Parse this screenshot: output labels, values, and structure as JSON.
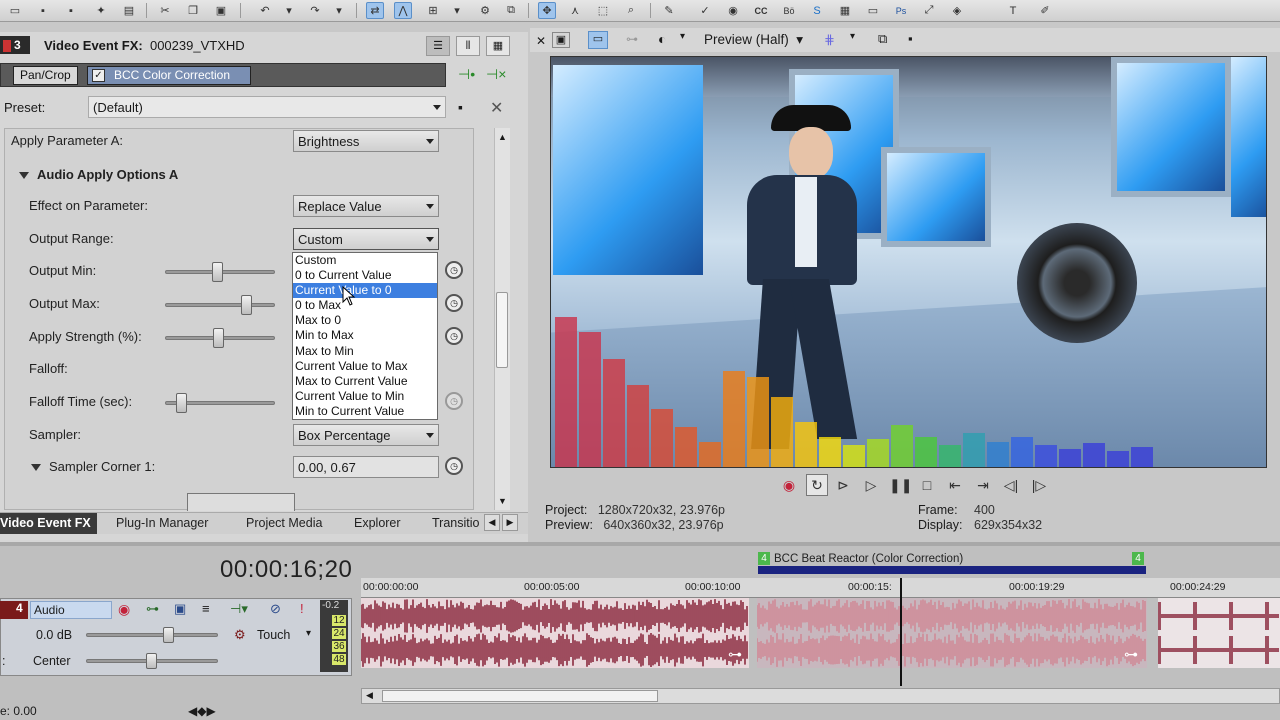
{
  "fx_panel": {
    "track_number": "3",
    "title_label": "Video Event FX:",
    "title_value": "000239_VTXHD",
    "chain": [
      "Pan/Crop",
      "BCC Color Correction"
    ],
    "preset_label": "Preset:",
    "preset_value": "(Default)",
    "params": {
      "apply_param_a_label": "Apply Parameter A:",
      "apply_param_a_value": "Brightness",
      "audio_options_label": "Audio Apply Options A",
      "effect_label": "Effect on Parameter:",
      "effect_value": "Replace Value",
      "output_range_label": "Output Range:",
      "output_range_value": "Custom",
      "output_min_label": "Output Min:",
      "output_max_label": "Output Max:",
      "apply_strength_label": "Apply Strength (%):",
      "falloff_label": "Falloff:",
      "falloff_time_label": "Falloff Time (sec):",
      "sampler_label": "Sampler:",
      "sampler_value": "Box Percentage",
      "sampler_corner_label": "Sampler Corner 1:",
      "sampler_corner_value": "0.00, 0.67"
    },
    "dropdown_options": [
      "Custom",
      "0 to Current Value",
      "Current Value to 0",
      "0 to Max",
      "Max to 0",
      "Min to Max",
      "Max to Min",
      "Current Value to Max",
      "Max to Current Value",
      "Current Value to Min",
      "Min to Current Value"
    ],
    "dropdown_selected_index": 2
  },
  "tabs": [
    "Video Event FX",
    "Plug-In Manager",
    "Project Media",
    "Explorer",
    "Transitio"
  ],
  "preview": {
    "mode_label": "Preview (Half)",
    "project_label": "Project:",
    "project_value": "1280x720x32, 23.976p",
    "preview_label": "Preview:",
    "preview_value": "640x360x32, 23.976p",
    "frame_label": "Frame:",
    "frame_value": "400",
    "display_label": "Display:",
    "display_value": "629x354x32"
  },
  "timeline": {
    "timecode": "00:00:16;20",
    "ruler_ticks": [
      "00:00:00:00",
      "00:00:05:00",
      "00:00:10:00",
      "00:00:15:",
      "00:00:19:29",
      "00:00:24:29"
    ],
    "event_label": "BCC Beat Reactor (Color Correction)",
    "event_marker": "4",
    "track": {
      "number": "4",
      "name": "Audio",
      "volume": "0.0 dB",
      "automation": "Touch",
      "pan": "Center",
      "meter_values": [
        "-0.2",
        "12",
        "24",
        "36",
        "48"
      ]
    },
    "status": "e: 0.00"
  },
  "colors": {
    "selection": "#3d7fe0",
    "event_bar": "#1a2380",
    "marker_green": "#4cb84c",
    "waveform": "#8a2a3e",
    "waveform_selected": "#d08a97"
  }
}
